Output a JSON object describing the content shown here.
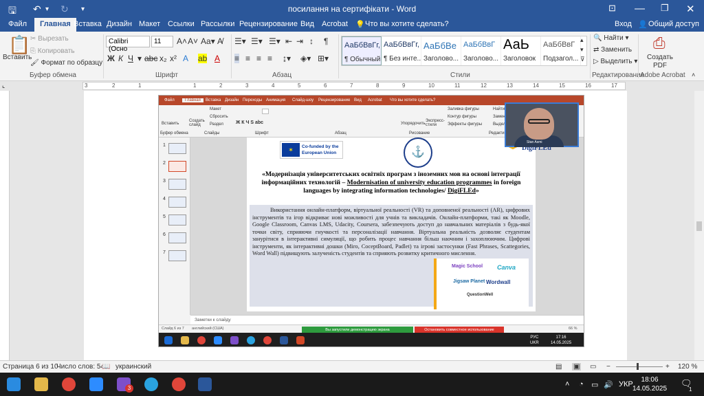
{
  "titlebar": {
    "title": "посилання на сертифікати - Word",
    "signin": "Вход",
    "share": "Общий доступ"
  },
  "tabs": [
    "Файл",
    "Главная",
    "Вставка",
    "Дизайн",
    "Макет",
    "Ссылки",
    "Рассылки",
    "Рецензирование",
    "Вид",
    "Acrobat"
  ],
  "tell_me": "Что вы хотите сделать?",
  "clipboard": {
    "paste": "Вставить",
    "cut": "Вырезать",
    "copy": "Копировать",
    "format_painter": "Формат по образцу",
    "label": "Буфер обмена"
  },
  "font": {
    "name": "Calibri (Осно",
    "size": "11",
    "label": "Шрифт",
    "aa": "Aa"
  },
  "paragraph": {
    "label": "Абзац"
  },
  "styles": {
    "label": "Стили",
    "items": [
      {
        "top": "АаБбВвГг,",
        "name": "¶ Обычный"
      },
      {
        "top": "АаБбВвГг,",
        "name": "¶ Без инте..."
      },
      {
        "top": "АаБбВе",
        "name": "Заголово..."
      },
      {
        "top": "АаБбВвГ",
        "name": "Заголово..."
      },
      {
        "top": "АаЬ",
        "name": "Заголовок"
      },
      {
        "top": "АаБбВвГ",
        "name": "Подзагол..."
      }
    ]
  },
  "editing": {
    "find": "Найти",
    "replace": "Заменить",
    "select": "Выделить",
    "label": "Редактирование"
  },
  "acrobat": {
    "create_pdf": "Создать PDF",
    "label": "Adobe Acrobat"
  },
  "ruler_ticks": [
    "3",
    "2",
    "1",
    "1",
    "2",
    "3",
    "4",
    "5",
    "6",
    "7",
    "8",
    "9",
    "10",
    "11",
    "12",
    "13",
    "14",
    "15",
    "16",
    "17",
    "18"
  ],
  "ppt": {
    "tabs": [
      "Файл",
      "Главная",
      "Вставка",
      "Дизайн",
      "Переходы",
      "Анимация",
      "Слайд-шоу",
      "Рецензирование",
      "Вид",
      "Acrobat"
    ],
    "tell_me": "Что вы хотите сделать?",
    "group_labels": [
      "Буфер обмена",
      "Слайды",
      "Шрифт",
      "Абзац",
      "Рисование",
      "Редактирование"
    ],
    "ribbon_buttons": [
      "Вставить",
      "Создать слайд",
      "Макет",
      "Сбросить",
      "Раздел",
      "Упорядочить",
      "Экспресс-стили",
      "Заливка фигуры",
      "Контур фигуры",
      "Эффекты фигуры",
      "Найти",
      "Заменить",
      "Выделить"
    ],
    "slide_numbers": [
      "1",
      "2",
      "3",
      "4",
      "5",
      "6",
      "7"
    ],
    "slide": {
      "eu_text": "Co-funded by the European Union",
      "digi": "DigiFLEd",
      "heading_a": "«Модернізація університетських освітніх програм з іноземних мов на основі інтеграції інформаційних технологій – ",
      "heading_b": "Modernisation of university education programmes",
      "heading_c": " in foreign languages by integrating information technologies/ ",
      "heading_d": "DigiFLEd",
      "heading_e": "»",
      "body": "Використання онлайн-платформ, віртуальної реальності (VR) та доповненої реальності (AR), цифрових інструментів та ігор відкриває нові можливості для учнів та викладачів. Онлайн-платформи, такі як Moodle, Google Classroom, Canvas LMS, Udacity, Coursera, забезпечують доступ до навчальних матеріалів з будь-якої точки світу, сприяючи гнучкості та персоналізації навчання. Віртуальна реальність дозволяє студентам занурітися в інтерактивні симуляції, що робить процес навчання більш наочним і захоплюючим. Цифрові інструменти, як інтерактивні дошки (Miro, CoceptBoard, Padlet) та ігрові застосунки (Fast Phrases, Scattegories, Word Wall) підвищують залученість студентів та сприяють розвитку критичного мислення.",
      "tools": [
        "Magic School",
        "Canva",
        "Jigsaw Planet",
        "Wordwall",
        "QuestionWell"
      ]
    },
    "notes": "Заметки к слайду",
    "status_left": "Слайд 6 из 7",
    "status_lang": "английский (США)",
    "zoom": "66 %",
    "share_msg": "Вы запустили демонстрацию экрана",
    "stop_share": "Остановить совместное использование",
    "lang": "РУС",
    "lang2": "UKR",
    "time": "17:16",
    "date": "14.05.2025"
  },
  "camera": {
    "name": "Stan Asmi"
  },
  "status": {
    "page": "Страница 6 из 10",
    "words": "Число слов: 54",
    "lang": "украинский",
    "zoom": "120 %"
  },
  "taskbar": {
    "lang": "УКР",
    "time": "18:06",
    "date": "14.05.2025",
    "viber_badge": "3",
    "notif_count": "1"
  }
}
